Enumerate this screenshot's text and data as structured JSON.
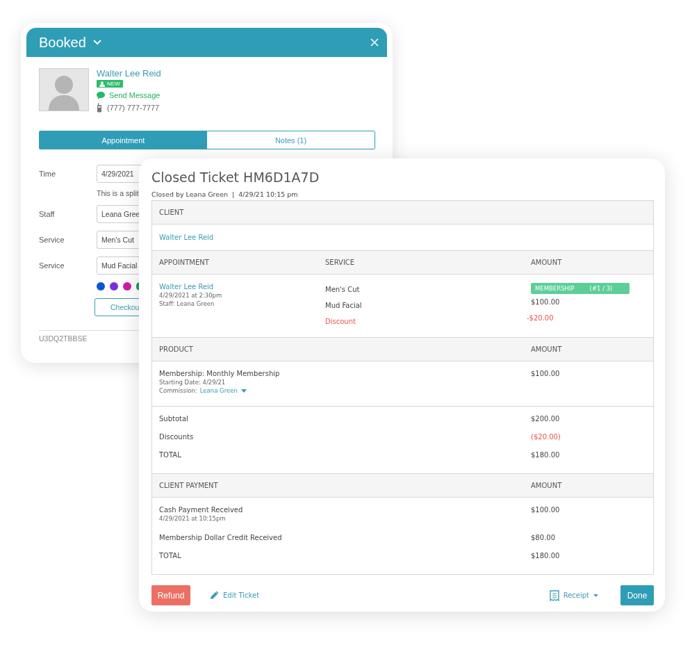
{
  "booking_window": {
    "title": "Booked",
    "client": {
      "name": "Walter Lee Reid",
      "badge": "NEW",
      "message_link": "Send Message",
      "phone": "(777) 777-7777"
    },
    "tabs": [
      {
        "label": "Appointment",
        "selected": true
      },
      {
        "label": "Notes (1)",
        "selected": false
      }
    ],
    "fields": [
      {
        "kind": "input",
        "label": "Time",
        "value": "4/29/2021"
      },
      {
        "kind": "note",
        "value": "This is a split"
      },
      {
        "kind": "input",
        "label": "Staff",
        "value": "Leana Gree"
      },
      {
        "kind": "input",
        "label": "Service",
        "value": "Men's Cut"
      },
      {
        "kind": "input",
        "label": "Service",
        "value": "Mud Facial"
      }
    ],
    "color_options": [
      {
        "color": "#0a57d0"
      },
      {
        "color": "#7b2ee0"
      },
      {
        "color": "#d21aa8"
      },
      {
        "color": "#1a9a6a"
      }
    ],
    "checkout_button": "Checkou",
    "code": "U3DQ2TBBSE"
  },
  "ticket": {
    "title": "Closed Ticket HM6D1A7D",
    "closed_by": "Closed by Leana Green  |  4/29/21 10:15 pm",
    "client_section": {
      "header": "CLIENT",
      "name": "Walter Lee Reid"
    },
    "appointment_section": {
      "headers": [
        "APPOINTMENT",
        "SERVICE",
        "AMOUNT"
      ],
      "client": "Walter Lee Reid",
      "date": "4/29/2021 at 2:30pm",
      "staff": "Staff: Leana Green",
      "lines": [
        {
          "service": "Men's Cut",
          "kind": "badge",
          "badge": "MEMBERSHIP",
          "badge_count": "(#1 / 3)"
        },
        {
          "service": "Mud Facial",
          "kind": "amount",
          "amount": "$100.00"
        },
        {
          "service": "Discount",
          "kind": "discount",
          "amount": "-$20.00"
        }
      ]
    },
    "product_section": {
      "headers": [
        "PRODUCT",
        "AMOUNT"
      ],
      "item": "Membership: Monthly Membership",
      "starting_date": "Starting Date: 4/29/21",
      "commission_label": "Commission:",
      "commission_staff": "Leana Green",
      "amount": "$100.00"
    },
    "totals": [
      {
        "label": "Subtotal",
        "value": "$200.00",
        "kind": "normal"
      },
      {
        "label": "Discounts",
        "value": "($20.00)",
        "kind": "discount"
      },
      {
        "label": "TOTAL",
        "value": "$180.00",
        "kind": "normal"
      }
    ],
    "payment_section": {
      "headers": [
        "CLIENT PAYMENT",
        "AMOUNT"
      ],
      "lines": [
        {
          "label": "Cash Payment Received",
          "detail": "4/29/2021 at 10:15pm",
          "amount": "$100.00"
        },
        {
          "label": "Membership Dollar Credit Received",
          "amount": "$80.00"
        },
        {
          "label": "TOTAL",
          "amount": "$180.00"
        }
      ]
    },
    "buttons": {
      "refund": "Refund",
      "edit": "Edit Ticket",
      "receipt": "Receipt",
      "done": "Done"
    }
  }
}
